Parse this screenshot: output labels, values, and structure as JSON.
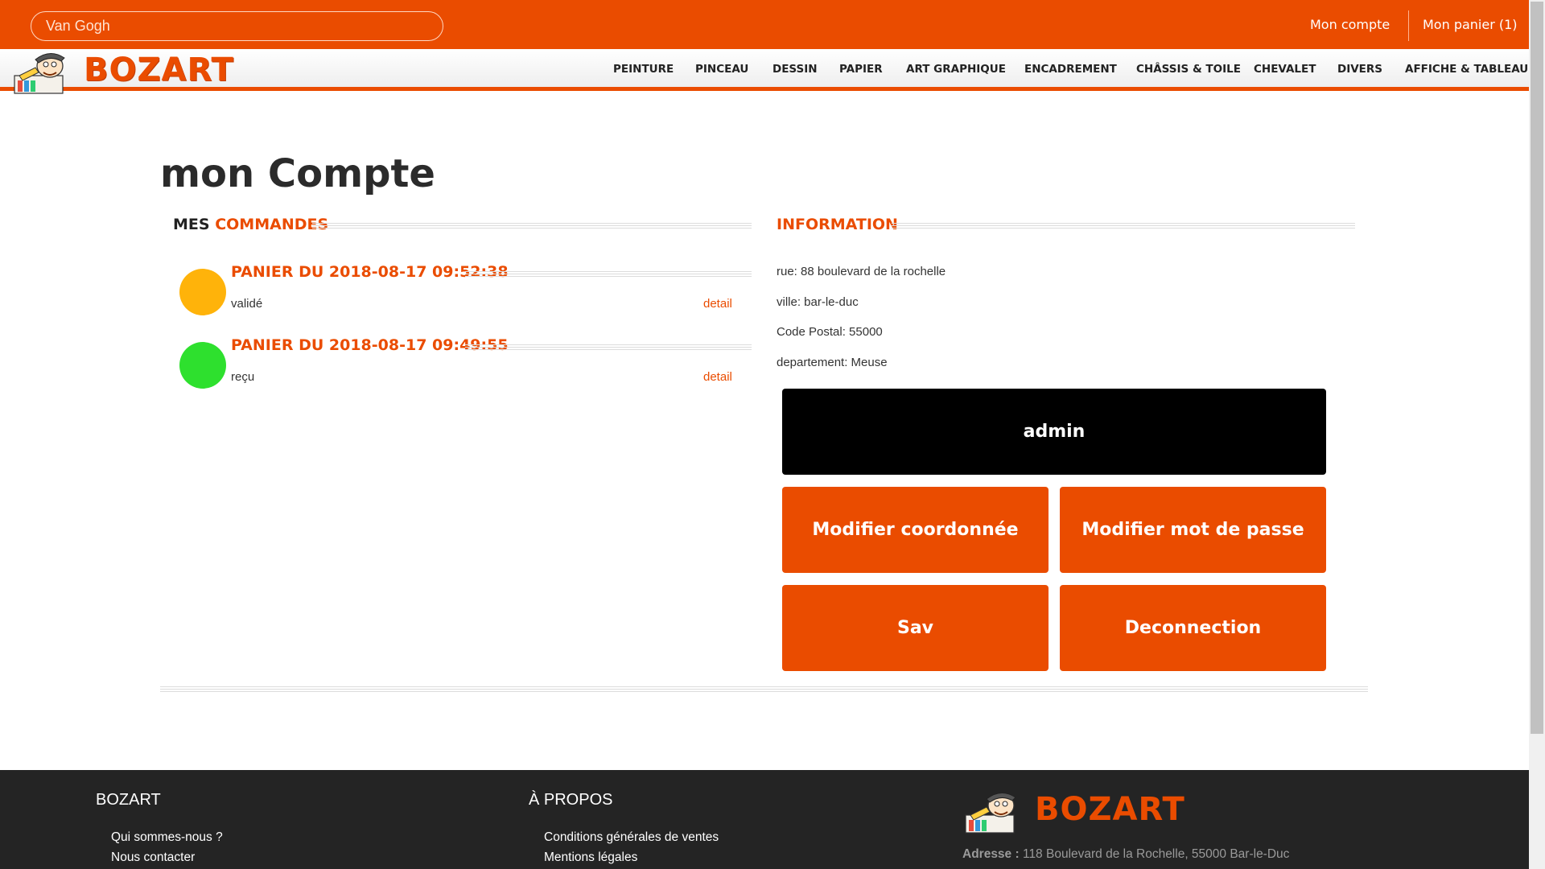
{
  "header": {
    "search_value": "Van Gogh",
    "account_label": "Mon compte",
    "cart_label": "Mon panier (1)"
  },
  "brand": {
    "name": "BOZART",
    "accent": "#ea4c00"
  },
  "nav": {
    "items": [
      {
        "label": "PEINTURE"
      },
      {
        "label": "PINCEAU"
      },
      {
        "label": "DESSIN"
      },
      {
        "label": "PAPIER"
      },
      {
        "label": "ART GRAPHIQUE"
      },
      {
        "label": "ENCADREMENT"
      },
      {
        "label": "CHÂSSIS & TOILE"
      },
      {
        "label": "CHEVALET"
      },
      {
        "label": "DIVERS"
      },
      {
        "label": "AFFICHE & TABLEAU"
      }
    ]
  },
  "main": {
    "title": "mon Compte",
    "orders_heading_dark": "MES",
    "orders_heading_orange": "COMMANDES",
    "orders": [
      {
        "title": "PANIER DU 2018-08-17 09:52:38",
        "status": "validé",
        "detail": "detail",
        "status_color": "#ffb30a"
      },
      {
        "title": "PANIER DU 2018-08-17 09:49:55",
        "status": "reçu",
        "detail": "detail",
        "status_color": "#2ee02e"
      }
    ],
    "info_heading": "INFORMATION",
    "info": {
      "street": "rue: 88 boulevard de la rochelle",
      "city": "ville: bar-le-duc",
      "postal": "Code Postal: 55000",
      "department": "departement: Meuse"
    },
    "buttons": {
      "admin": "admin",
      "edit_details": "Modifier coordonnée",
      "edit_password": "Modifier mot de passe",
      "sav": "Sav",
      "logout": "Deconnection"
    }
  },
  "footer": {
    "col1_heading": "BOZART",
    "col1_links": [
      "Qui sommes-nous ?",
      "Nous contacter"
    ],
    "col2_heading": "À PROPOS",
    "col2_links": [
      "Conditions générales de ventes",
      "Mentions légales"
    ],
    "address_label": "Adresse :",
    "address_value": "118 Boulevard de la Rochelle, 55000 Bar-le-Duc"
  }
}
